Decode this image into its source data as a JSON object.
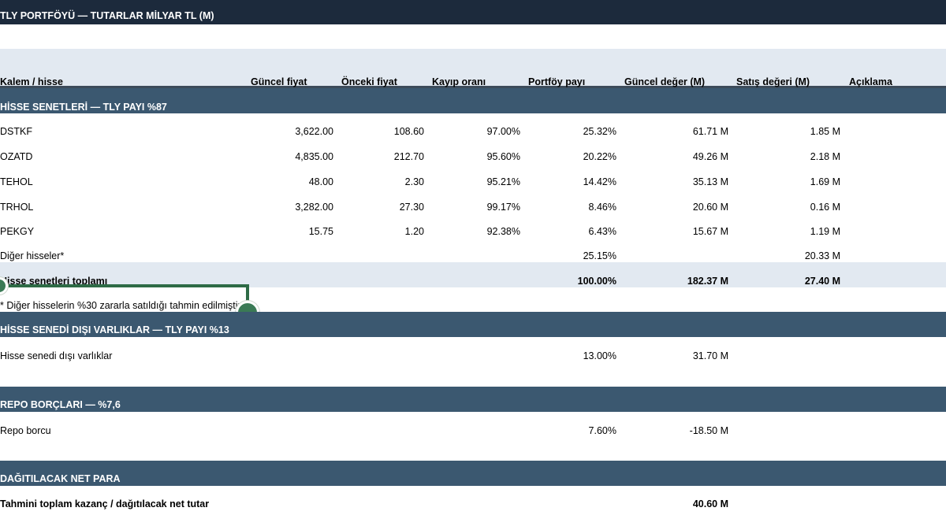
{
  "title": "TLY PORTFÖYÜ — TUTARLAR MİLYAR TL (M)",
  "columns": [
    "Kalem / hisse",
    "Güncel fiyat",
    "Önceki fiyat",
    "Kayıp oranı",
    "Portföy payı",
    "Güncel değer (M)",
    "Satış değeri (M)",
    "Açıklama"
  ],
  "section_equity": {
    "title": "HİSSE SENETLERİ — TLY PAYI %87",
    "rows": [
      {
        "name": "DSTKF",
        "cur": "3,622.00",
        "prev": "108.60",
        "loss": "97.00%",
        "share": "25.32%",
        "value": "61.71 M",
        "sale": "1.85 M"
      },
      {
        "name": "OZATD",
        "cur": "4,835.00",
        "prev": "212.70",
        "loss": "95.60%",
        "share": "20.22%",
        "value": "49.26 M",
        "sale": "2.18 M"
      },
      {
        "name": "TEHOL",
        "cur": "48.00",
        "prev": "2.30",
        "loss": "95.21%",
        "share": "14.42%",
        "value": "35.13 M",
        "sale": "1.69 M"
      },
      {
        "name": "TRHOL",
        "cur": "3,282.00",
        "prev": "27.30",
        "loss": "99.17%",
        "share": "8.46%",
        "value": "20.60 M",
        "sale": "0.16 M"
      },
      {
        "name": "PEKGY",
        "cur": "15.75",
        "prev": "1.20",
        "loss": "92.38%",
        "share": "6.43%",
        "value": "15.67 M",
        "sale": "1.19 M"
      }
    ],
    "other": {
      "name": "Diğer hisseler*",
      "share": "25.15%",
      "sale": "20.33 M"
    },
    "total": {
      "name": "Hisse senetleri toplamı",
      "share": "100.00%",
      "value": "182.37 M",
      "sale": "27.40 M"
    },
    "footnote": "* Diğer hisselerin %30 zararla satıldığı tahmin edilmiştir"
  },
  "section_nonequity": {
    "title": "HİSSE SENEDİ DIŞI VARLIKLAR — TLY PAYI %13",
    "row": {
      "name": "Hisse senedi dışı varlıklar",
      "share": "13.00%",
      "value": "31.70 M"
    }
  },
  "section_repo": {
    "title": "REPO BORÇLARI — %7,6",
    "row": {
      "name": "Repo borcu",
      "share": "7.60%",
      "value": "-18.50 M"
    }
  },
  "section_net": {
    "title": "DAĞITILACAK NET PARA",
    "row": {
      "name": "Tahmini toplam kazanç / dağıtılacak net tutar",
      "value": "40.60 M"
    }
  },
  "colors": {
    "title_bar": "#1c2a3c",
    "section_bar": "#3b5870",
    "header_bg": "#e2e9f1",
    "annotation": "#2e6b46"
  }
}
